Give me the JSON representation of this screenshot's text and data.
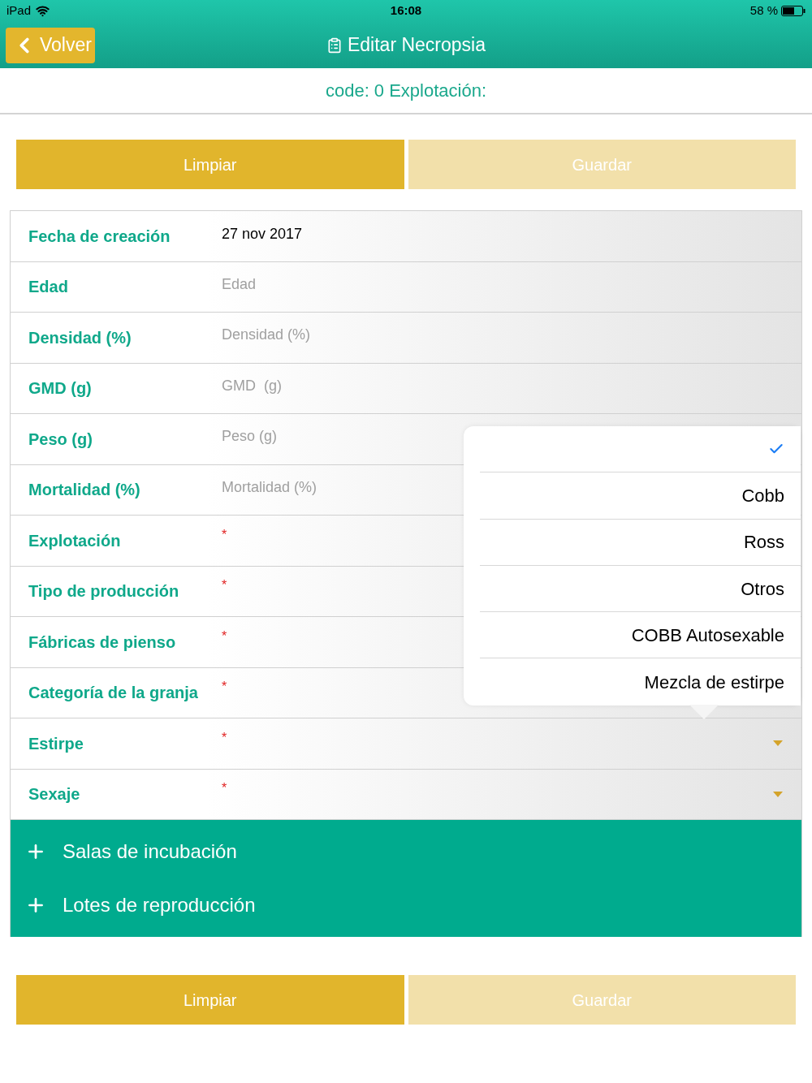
{
  "status_bar": {
    "device": "iPad",
    "time": "16:08",
    "battery": "58 %"
  },
  "nav": {
    "back": "Volver",
    "title": "Editar Necropsia"
  },
  "subtitle": "code: 0 Explotación:",
  "top_buttons": [
    {
      "label": "Limpiar",
      "disabled": false
    },
    {
      "label": "Guardar",
      "disabled": true
    }
  ],
  "fields": [
    {
      "kind": "date",
      "label": "Fecha de creación",
      "value": "27 nov 2017"
    },
    {
      "kind": "text",
      "label": "Edad",
      "placeholder": "Edad"
    },
    {
      "kind": "text",
      "label": "Densidad (%)",
      "placeholder": "Densidad (%)"
    },
    {
      "kind": "text",
      "label": "GMD (g)",
      "placeholder": "GMD  (g)"
    },
    {
      "kind": "text",
      "label": "Peso (g)",
      "placeholder": "Peso (g)"
    },
    {
      "kind": "text",
      "label": "Mortalidad (%)",
      "placeholder": "Mortalidad (%)"
    },
    {
      "kind": "required",
      "label": "Explotación",
      "mark": "*"
    },
    {
      "kind": "required",
      "label": "Tipo de producción",
      "mark": "*"
    },
    {
      "kind": "required",
      "label": "Fábricas de pienso",
      "mark": "*"
    },
    {
      "kind": "required",
      "label": "Categoría de la granja",
      "mark": "*"
    },
    {
      "kind": "select",
      "label": "Estirpe",
      "mark": "*"
    },
    {
      "kind": "select",
      "label": "Sexaje",
      "mark": "*"
    }
  ],
  "sections": [
    {
      "label": "Salas de incubación",
      "expanded": false
    },
    {
      "label": "Lotes de reproducción",
      "expanded": false
    }
  ],
  "bottom_buttons": [
    {
      "label": "Limpiar",
      "disabled": false
    },
    {
      "label": "Guardar",
      "disabled": true
    }
  ],
  "popover": {
    "options": [
      {
        "selected": true
      },
      {
        "label": "Cobb",
        "selected": false
      },
      {
        "label": "Ross",
        "selected": false
      },
      {
        "label": "Otros",
        "selected": false
      },
      {
        "label": "COBB Autosexable",
        "selected": false
      },
      {
        "label": "Mezcla de estirpe",
        "selected": false
      }
    ]
  }
}
